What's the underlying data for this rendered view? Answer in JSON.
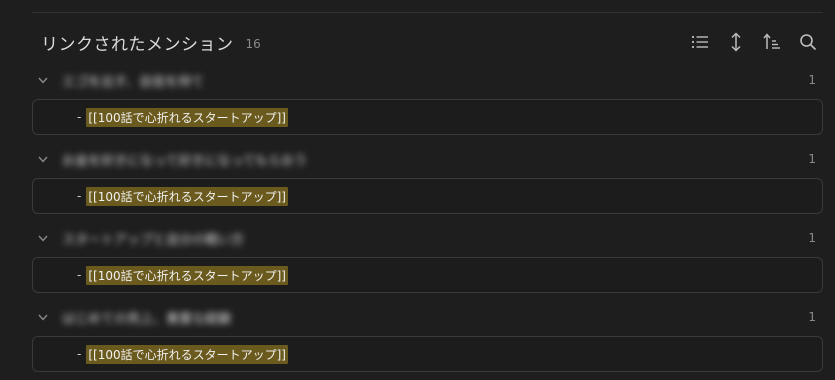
{
  "header": {
    "title": "リンクされたメンション",
    "count": "16",
    "tools": [
      {
        "name": "list-icon"
      },
      {
        "name": "expand-collapse-icon"
      },
      {
        "name": "sort-icon"
      },
      {
        "name": "search-icon"
      }
    ]
  },
  "groups": [
    {
      "title": "エゴを出す、自信を持て",
      "count": "1",
      "match_dash": "-",
      "match_link": "[[100話で心折れるスタートアップ]]"
    },
    {
      "title": "お金を好きになって好きになってもらおう",
      "count": "1",
      "match_dash": "-",
      "match_link": "[[100話で心折れるスタートアップ]]"
    },
    {
      "title": "スタートアップと自分の戦い方",
      "count": "1",
      "match_dash": "-",
      "match_link": "[[100話で心折れるスタートアップ]]"
    },
    {
      "title": "はじめての売上、貴重な経験",
      "count": "1",
      "match_dash": "-",
      "match_link": "[[100話で心折れるスタートアップ]]"
    }
  ],
  "colors": {
    "background": "#1e1e1e",
    "highlight": "#6b5a1e",
    "border": "#3a3a3a"
  }
}
